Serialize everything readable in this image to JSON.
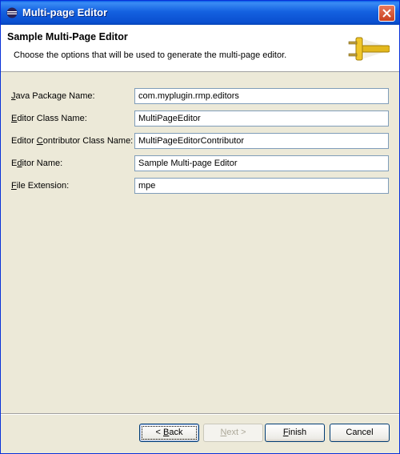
{
  "window": {
    "title": "Multi-page Editor"
  },
  "header": {
    "title": "Sample Multi-Page Editor",
    "description": "Choose the options that will be used to generate the multi-page editor.",
    "icon": "plug-icon"
  },
  "fields": [
    {
      "pre": "",
      "mnemonic": "J",
      "post": "ava Package Name:",
      "value": "com.myplugin.rmp.editors"
    },
    {
      "pre": "",
      "mnemonic": "E",
      "post": "ditor Class Name:",
      "value": "MultiPageEditor"
    },
    {
      "pre": "Editor ",
      "mnemonic": "C",
      "post": "ontributor Class Name:",
      "value": "MultiPageEditorContributor"
    },
    {
      "pre": "E",
      "mnemonic": "d",
      "post": "itor Name:",
      "value": "Sample Multi-page Editor"
    },
    {
      "pre": "",
      "mnemonic": "F",
      "post": "ile Extension:",
      "value": "mpe"
    }
  ],
  "buttons": {
    "back": {
      "pre": "< ",
      "mnemonic": "B",
      "post": "ack"
    },
    "next": {
      "pre": "",
      "mnemonic": "N",
      "post": "ext >"
    },
    "finish": {
      "pre": "",
      "mnemonic": "F",
      "post": "inish"
    },
    "cancel": {
      "pre": "",
      "mnemonic": "",
      "post": "Cancel"
    }
  }
}
